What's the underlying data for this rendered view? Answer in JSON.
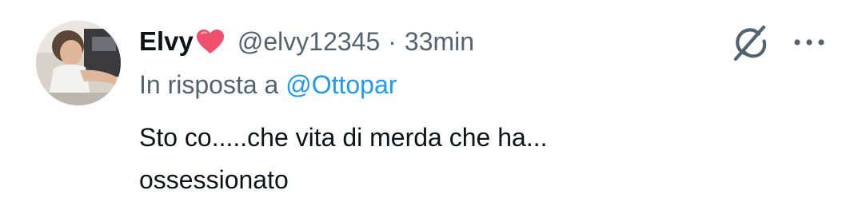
{
  "tweet": {
    "display_name": "Elvy",
    "name_emoji": "heart-emoji",
    "handle": "@elvy12345",
    "separator": "·",
    "time": "33min",
    "reply_prefix": "In risposta a",
    "reply_mention": "@Ottopar",
    "text": "Sto co.....che vita di merda che ha...\nossessionato"
  },
  "icons": {
    "grok": "grok-icon",
    "more": "more-options-icon",
    "heart": "heart-emoji"
  },
  "colors": {
    "text_primary": "#0f1419",
    "text_secondary": "#536471",
    "link": "#1d9bf0",
    "heart": "#f0506e"
  }
}
